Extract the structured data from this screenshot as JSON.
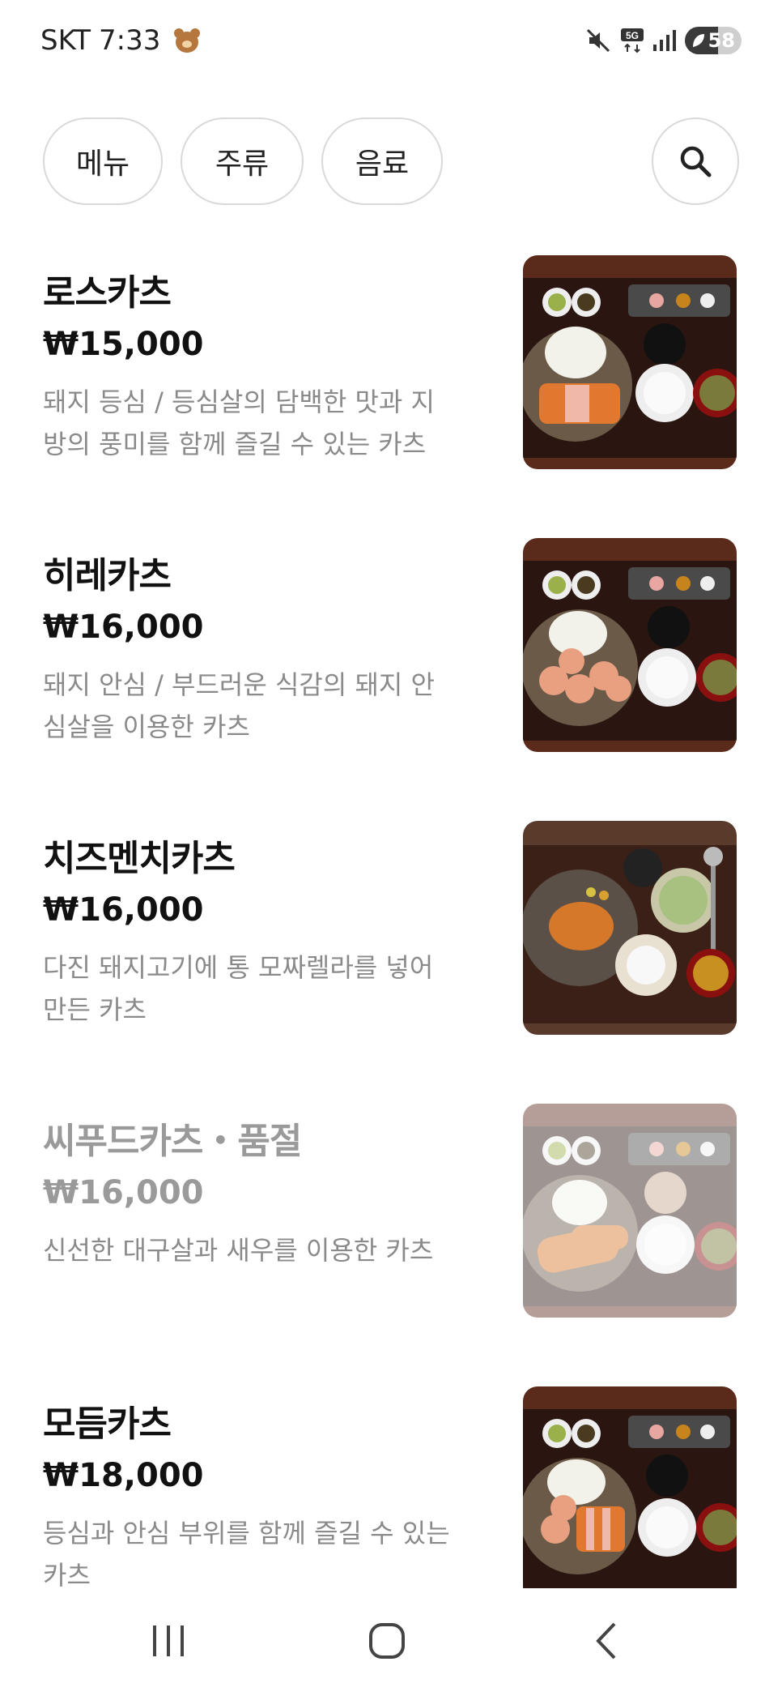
{
  "status_bar": {
    "carrier": "SKT",
    "time": "7:33",
    "network": "5G",
    "battery": "58",
    "battery_level": 0.58
  },
  "tabs": [
    {
      "label": "메뉴",
      "active": true
    },
    {
      "label": "주류",
      "active": false
    },
    {
      "label": "음료",
      "active": false
    }
  ],
  "menu_items": [
    {
      "name": "로스카츠",
      "price": "₩15,000",
      "description": "돼지 등심 / 등심살의 담백한 맛과 지방의 풍미를 함께 즐길 수 있는 카츠",
      "sold_out": false
    },
    {
      "name": "히레카츠",
      "price": "₩16,000",
      "description": "돼지 안심 / 부드러운 식감의 돼지 안심살을 이용한 카츠",
      "sold_out": false
    },
    {
      "name": "치즈멘치카츠",
      "price": "₩16,000",
      "description": "다진 돼지고기에 통 모짜렐라를 넣어 만든 카츠",
      "sold_out": false
    },
    {
      "name": "씨푸드카츠・품절",
      "price": "₩16,000",
      "description": "신선한 대구살과 새우를 이용한 카츠",
      "sold_out": true
    },
    {
      "name": "모듬카츠",
      "price": "₩18,000",
      "description": "등심과 안심 부위를 함께 즐길 수 있는 카츠",
      "sold_out": false
    }
  ],
  "colors": {
    "active_tab": "#1d1f23",
    "border": "#d9d9d9",
    "description": "#8a8a8a"
  }
}
